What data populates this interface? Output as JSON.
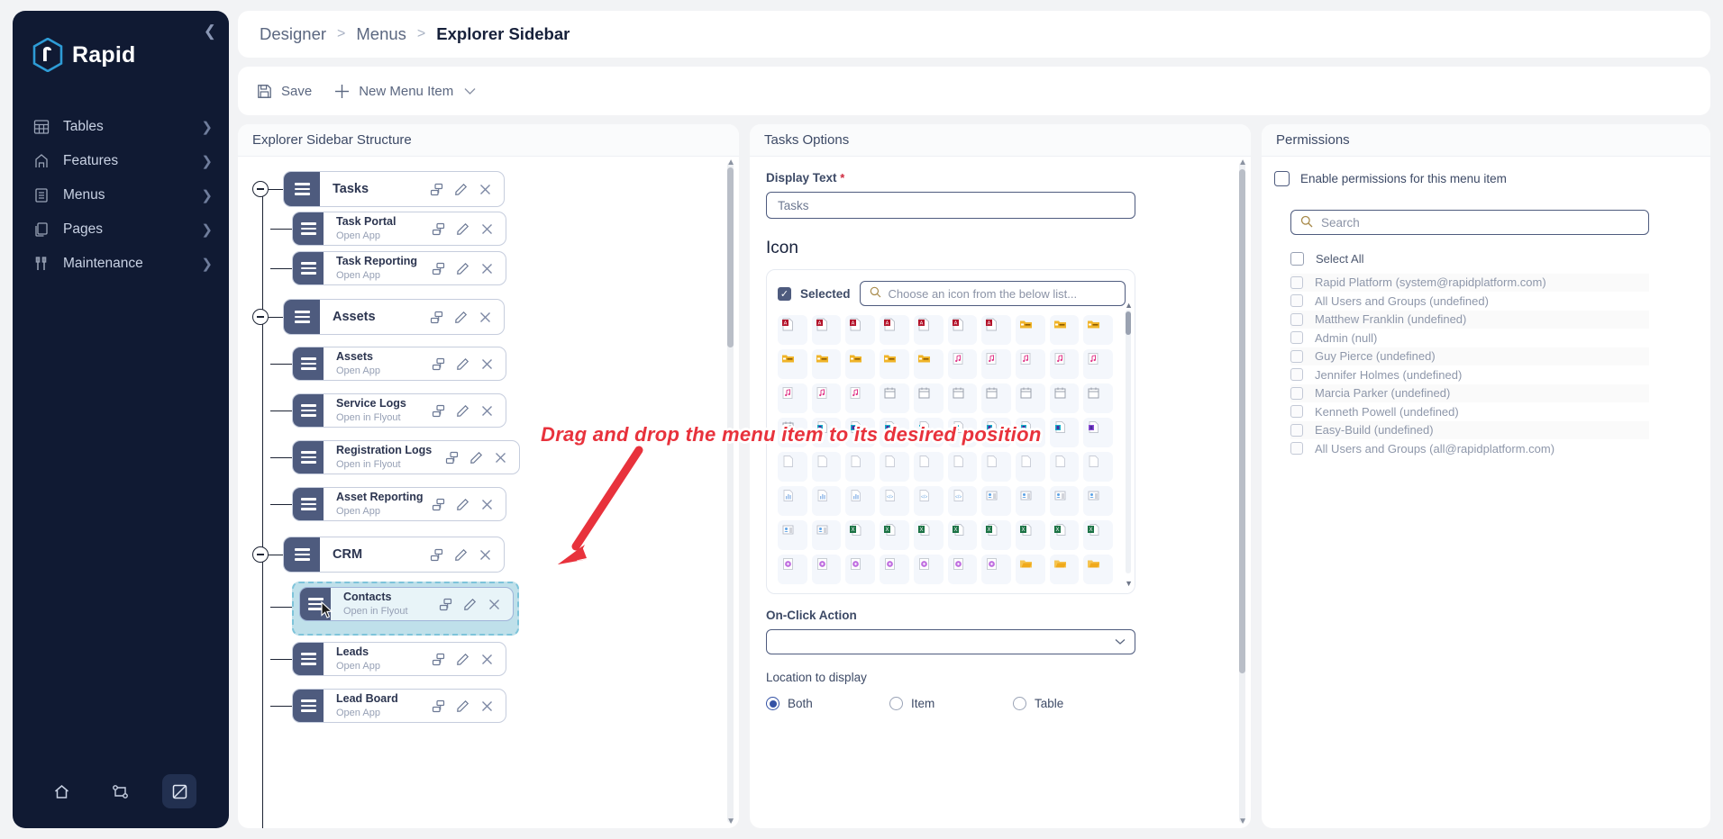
{
  "brand": {
    "name": "Rapid",
    "logo_icon": "rapid-hexagon-logo",
    "collapse_icon": "chevron-left-icon"
  },
  "nav": {
    "items": [
      {
        "label": "Tables",
        "icon": "table-icon",
        "chevron": "chevron-right-icon"
      },
      {
        "label": "Features",
        "icon": "features-icon",
        "chevron": "chevron-right-icon"
      },
      {
        "label": "Menus",
        "icon": "menu-list-icon",
        "chevron": "chevron-right-icon"
      },
      {
        "label": "Pages",
        "icon": "pages-icon",
        "chevron": "chevron-right-icon"
      },
      {
        "label": "Maintenance",
        "icon": "maintenance-icon",
        "chevron": "chevron-right-icon"
      }
    ],
    "footer": [
      {
        "name": "home-icon",
        "active": false
      },
      {
        "name": "workflow-icon",
        "active": false
      },
      {
        "name": "designer-icon",
        "active": true
      }
    ]
  },
  "breadcrumb": {
    "items": [
      "Designer",
      "Menus",
      "Explorer Sidebar"
    ],
    "separator": ">"
  },
  "toolbar": {
    "save_label": "Save",
    "save_icon": "save-disk-icon",
    "new_item_label": "New Menu Item",
    "new_item_icon": "plus-icon",
    "new_item_caret": "chevron-down-icon"
  },
  "structure": {
    "title": "Explorer Sidebar Structure",
    "node_actions": [
      "duplicate-icon",
      "edit-pencil-icon",
      "delete-x-icon"
    ],
    "nodes": [
      {
        "label": "Tasks",
        "type": "root",
        "expanded": true,
        "children": [
          {
            "label": "Task Portal",
            "sub": "Open App"
          },
          {
            "label": "Task Reporting",
            "sub": "Open App"
          }
        ]
      },
      {
        "label": "Assets",
        "type": "root",
        "expanded": true,
        "children": [
          {
            "label": "Assets",
            "sub": "Open App"
          },
          {
            "label": "Service Logs",
            "sub": "Open in Flyout"
          },
          {
            "label": "Registration Logs",
            "sub": "Open in Flyout"
          },
          {
            "label": "Asset Reporting",
            "sub": "Open App"
          }
        ]
      },
      {
        "label": "CRM",
        "type": "root",
        "expanded": true,
        "children": [
          {
            "label": "Contacts",
            "sub": "Open in Flyout",
            "dragging": true
          },
          {
            "label": "Leads",
            "sub": "Open App"
          },
          {
            "label": "Lead Board",
            "sub": "Open App"
          }
        ]
      }
    ]
  },
  "options": {
    "title": "Tasks Options",
    "display_text": {
      "label": "Display Text",
      "required_mark": "*",
      "value": "Tasks"
    },
    "icon_section": {
      "heading": "Icon",
      "selected_label": "Selected",
      "selected_checked": true,
      "search_placeholder": "Choose an icon from the below list...",
      "search_icon": "search-icon",
      "grid_rows": [
        [
          "doc-red-a",
          "doc-red-a",
          "doc-red-a",
          "doc-red-a",
          "doc-red-a",
          "doc-red-a",
          "doc-red-a",
          "folder-amber",
          "folder-amber",
          "folder-amber"
        ],
        [
          "folder-amber",
          "folder-amber",
          "folder-amber",
          "folder-amber",
          "folder-amber",
          "doc-music",
          "doc-music",
          "doc-music",
          "doc-music",
          "doc-music"
        ],
        [
          "doc-music",
          "doc-music",
          "doc-music",
          "calendar",
          "calendar",
          "calendar",
          "calendar",
          "calendar",
          "calendar",
          "calendar"
        ],
        [
          "calendar",
          "doc-access",
          "doc-access",
          "doc-access",
          "doc-access",
          "doc-access",
          "doc-access",
          "doc-access",
          "doc-access",
          "doc-access-purple"
        ],
        [
          "doc-blank",
          "doc-blank",
          "doc-blank",
          "doc-blank",
          "doc-blank",
          "doc-blank",
          "doc-blank",
          "doc-blank",
          "doc-blank",
          "doc-blank"
        ],
        [
          "doc-chart",
          "doc-chart",
          "doc-chart",
          "doc-code",
          "doc-code",
          "doc-code",
          "doc-contact",
          "doc-contact",
          "doc-contact",
          "doc-contact"
        ],
        [
          "doc-contact",
          "doc-contact",
          "doc-excel",
          "doc-excel",
          "doc-excel",
          "doc-excel",
          "doc-excel",
          "doc-excel",
          "doc-excel",
          "doc-excel"
        ],
        [
          "doc-media",
          "doc-media",
          "doc-media",
          "doc-media",
          "doc-media",
          "doc-media",
          "doc-media",
          "folder-open",
          "folder-open",
          "folder-open"
        ]
      ]
    },
    "on_click_action": {
      "label": "On-Click Action",
      "value": "",
      "caret": "chevron-down-icon"
    },
    "location": {
      "label": "Location to display",
      "choices": [
        "Both",
        "Item",
        "Table"
      ],
      "selected": "Both"
    }
  },
  "permissions": {
    "title": "Permissions",
    "enable_label": "Enable permissions for this menu item",
    "enable_checked": false,
    "search_placeholder": "Search",
    "search_icon": "search-icon",
    "select_all_label": "Select All",
    "select_all_checked": false,
    "rows": [
      {
        "label": "Rapid Platform (system@rapidplatform.com)",
        "checked": false
      },
      {
        "label": "All Users and Groups (undefined)",
        "checked": false
      },
      {
        "label": "Matthew Franklin (undefined)",
        "checked": false
      },
      {
        "label": "Admin (null)",
        "checked": false
      },
      {
        "label": "Guy Pierce (undefined)",
        "checked": false
      },
      {
        "label": "Jennifer Holmes (undefined)",
        "checked": false
      },
      {
        "label": "Marcia Parker (undefined)",
        "checked": false
      },
      {
        "label": "Kenneth Powell (undefined)",
        "checked": false
      },
      {
        "label": "Easy-Build (undefined)",
        "checked": false
      },
      {
        "label": "All Users and Groups (all@rapidplatform.com)",
        "checked": false
      }
    ]
  },
  "annotation": {
    "text": "Drag and drop the menu item to its desired position",
    "color": "#e8323c",
    "arrow_icon": "arrow-down-left-icon"
  },
  "colors": {
    "nav_bg": "#101a33",
    "chip_grip": "#4e5b7e",
    "accent": "#3452a5",
    "drag_highlight": "#bfe0ea",
    "annotation_red": "#e8323c"
  }
}
